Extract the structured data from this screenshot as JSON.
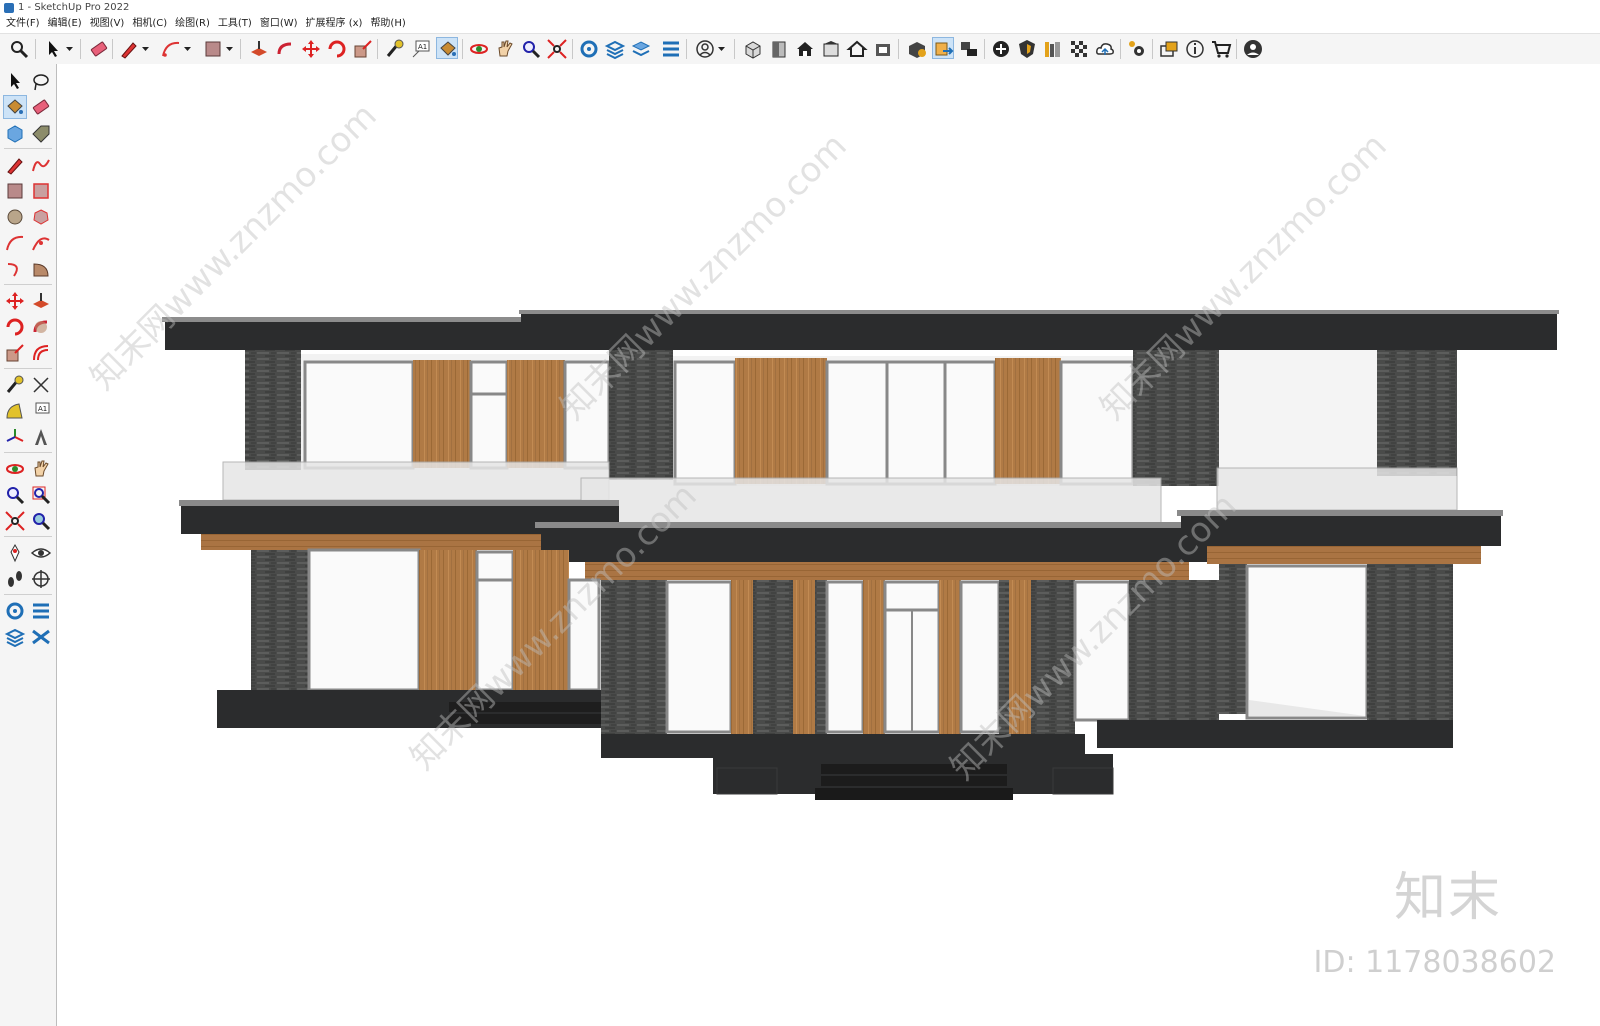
{
  "window": {
    "title": "1 - SketchUp Pro 2022"
  },
  "menu": [
    "文件(F)",
    "编辑(E)",
    "视图(V)",
    "相机(C)",
    "绘图(R)",
    "工具(T)",
    "窗口(W)",
    "扩展程序 (x)",
    "帮助(H)"
  ],
  "toolbar_icons": [
    "zoom-icon",
    "select-icon",
    "eraser-icon",
    "pencil-icon",
    "arc-icon",
    "rectangle-icon",
    "push-pull-icon",
    "follow-me-icon",
    "move-icon",
    "rotate-icon",
    "scale-icon",
    "tape-measure-icon",
    "text-icon",
    "paint-bucket-icon",
    "orbit-icon",
    "pan-icon",
    "zoom-window-icon",
    "zoom-extents-icon",
    "sandbox-icon",
    "layers-icon",
    "components-icon",
    "styles-icon",
    "user-icon",
    "iso-view-icon",
    "front-view-icon",
    "home-view-icon",
    "top-view-icon",
    "house-outline-icon",
    "section-icon",
    "warehouse-icon",
    "extension-warehouse-icon",
    "camera-icon",
    "add-icon",
    "shield-icon",
    "library-icon",
    "materials-icon",
    "cloud-icon",
    "settings-icon",
    "outliner-icon",
    "info-icon",
    "cart-icon",
    "account-icon"
  ],
  "watermark": {
    "brand": "知末",
    "id": "ID: 1178038602",
    "diagonal": "知末网www.znzmo.com"
  },
  "colors": {
    "roof": "#2a2b2c",
    "stone": "#4c4d4c",
    "wood": "#b07a45",
    "glass": "#f7f7f7",
    "frame": "#8a8a8a",
    "accent": "#2a6fb6"
  }
}
